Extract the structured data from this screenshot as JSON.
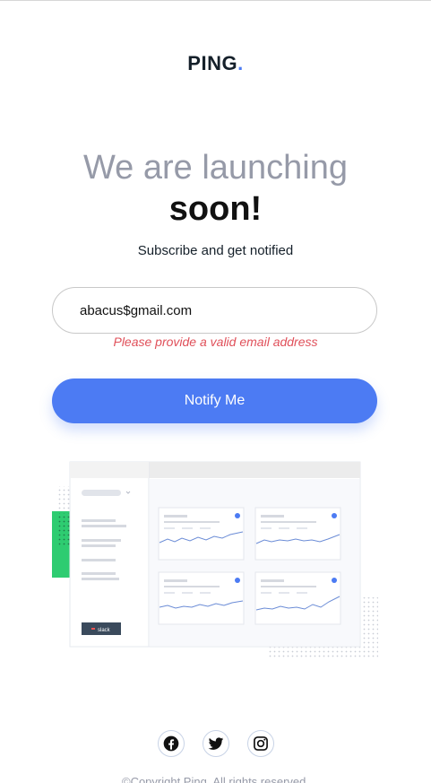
{
  "brand": {
    "name": "PING",
    "dot": "."
  },
  "headline": {
    "light": "We are launching",
    "bold": "soon!"
  },
  "subtitle": "Subscribe and get notified",
  "form": {
    "email_value": "abacus$gmail.com",
    "error": "Please provide a valid email address",
    "submit_label": "Notify Me"
  },
  "illustration": {
    "badge": "slack"
  },
  "socials": [
    {
      "name": "facebook-icon"
    },
    {
      "name": "twitter-icon"
    },
    {
      "name": "instagram-icon"
    }
  ],
  "footer": {
    "copyright": "©Copyright Ping. All rights reserved."
  },
  "colors": {
    "accent": "#4c7bf3",
    "error": "#e0505a",
    "muted": "#969aa8",
    "dark": "#15202a"
  }
}
